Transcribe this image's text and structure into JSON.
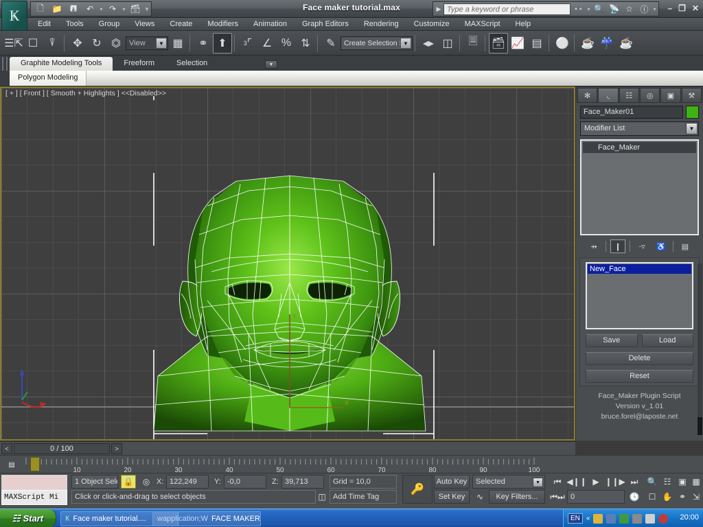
{
  "titlebar": {
    "app_title": "Face maker tutorial.max",
    "quick_access": [
      {
        "name": "new-file",
        "glyph": "⬜"
      },
      {
        "name": "open-file",
        "glyph": "📂"
      },
      {
        "name": "save-file",
        "glyph": "💾"
      },
      {
        "name": "undo",
        "glyph": "↶"
      },
      {
        "name": "redo",
        "glyph": "↷"
      },
      {
        "name": "set-project-folder",
        "glyph": "🗂"
      }
    ],
    "search_placeholder": "Type a keyword or phrase",
    "search_value": "",
    "help_icons": [
      "binoculars-icon",
      "magnifier-icon",
      "satellite-icon",
      "star-icon",
      "question-icon"
    ],
    "window_buttons": {
      "minimize": "–",
      "restore": "❐",
      "close": "✕"
    }
  },
  "menubar": {
    "items": [
      "Edit",
      "Tools",
      "Group",
      "Views",
      "Create",
      "Modifiers",
      "Animation",
      "Graph Editors",
      "Rendering",
      "Customize",
      "MAXScript",
      "Help"
    ]
  },
  "main_toolbar": {
    "view_dropdown": "View",
    "selection_set_dropdown": "Create Selection Se",
    "numeric_badge": "3"
  },
  "ribbon": {
    "tabs": [
      {
        "label": "Graphite Modeling Tools",
        "active": true
      },
      {
        "label": "Freeform",
        "active": false
      },
      {
        "label": "Selection",
        "active": false
      }
    ],
    "panel": "Polygon Modeling"
  },
  "viewport": {
    "label": "[ + ] [ Front ] [ Smooth + Highlights ] <<Disabled>>",
    "object_color": "#4caf18",
    "wire_color": "#ffffff",
    "grid_color": "#565656",
    "background": "#3f3f3f",
    "axis": {
      "x": "X",
      "y": "Y",
      "z": "Z"
    }
  },
  "command_panel": {
    "tabs": [
      {
        "name": "create-tab",
        "glyph": "✥",
        "active": false
      },
      {
        "name": "modify-tab",
        "glyph": "◩",
        "active": true
      },
      {
        "name": "hierarchy-tab",
        "glyph": "⛓",
        "active": false
      },
      {
        "name": "motion-tab",
        "glyph": "◎",
        "active": false
      },
      {
        "name": "display-tab",
        "glyph": "▣",
        "active": false
      },
      {
        "name": "utilities-tab",
        "glyph": "🔨",
        "active": false
      }
    ],
    "object_name": "Face_Maker01",
    "object_color": "#3fb313",
    "modifier_list_label": "Modifier List",
    "modifier_stack": [
      "Face_Maker"
    ],
    "stack_buttons": [
      {
        "name": "pin-stack-button",
        "glyph": "⊸"
      },
      {
        "name": "show-end-result-button",
        "glyph": "❙"
      },
      {
        "name": "make-unique-button",
        "glyph": "⑂"
      },
      {
        "name": "remove-modifier-button",
        "glyph": "🗑"
      },
      {
        "name": "configure-modifier-sets-button",
        "glyph": "▤"
      }
    ],
    "face_list": [
      "New_Face"
    ],
    "buttons": {
      "save": "Save",
      "load": "Load",
      "delete": "Delete",
      "reset": "Reset"
    },
    "credits": [
      "Face_Maker Plugin Script",
      "Version v_1.01",
      "bruce.forel@laposte.net"
    ]
  },
  "track_bar": {
    "prev_key": "<",
    "next_key": ">",
    "current_frame": "0 / 100"
  },
  "timeline": {
    "ticks": [
      0,
      10,
      20,
      30,
      40,
      50,
      60,
      70,
      80,
      90,
      100
    ],
    "labels": [
      "",
      "10",
      "20",
      "30",
      "40",
      "50",
      "60",
      "70",
      "80",
      "90",
      "100"
    ],
    "slider_frame": 0
  },
  "status_bar": {
    "maxscript_mini_listener": "MAXScript Mi",
    "selection_status": "1 Object Sele",
    "coords": {
      "x_label": "X:",
      "x_value": "122,249",
      "y_label": "Y:",
      "y_value": "-0,0",
      "z_label": "Z:",
      "z_value": "39,713"
    },
    "grid_info": "Grid = 10,0",
    "add_time_tag": "Add Time Tag",
    "prompt": "Click or click-and-drag to select objects",
    "auto_key": "Auto Key",
    "set_key": "Set Key",
    "key_mode_dropdown": "Selected",
    "key_filters": "Key Filters...",
    "frame_spinner": "0",
    "nav_icons": [
      "go-to-start-icon",
      "previous-frame-icon",
      "play-animation-icon",
      "next-frame-icon",
      "go-to-end-icon",
      "key-mode-toggle-icon",
      "time-configuration-icon",
      "zoom-icon",
      "zoom-all-icon",
      "zoom-extents-icon",
      "zoom-extents-all-icon",
      "zoom-region-icon",
      "pan-view-icon",
      "orbit-icon",
      "maximize-viewport-icon"
    ]
  },
  "taskbar": {
    "start_label": "Start",
    "tasks": [
      {
        "label": "Face maker tutorial....",
        "icon": "3dsmax-icon"
      },
      {
        "label": "FACE MAKER - Microsoft ...",
        "icon": "word-icon"
      }
    ],
    "language_indicator": "EN",
    "tray_expand": "«",
    "clock": "20:00"
  }
}
